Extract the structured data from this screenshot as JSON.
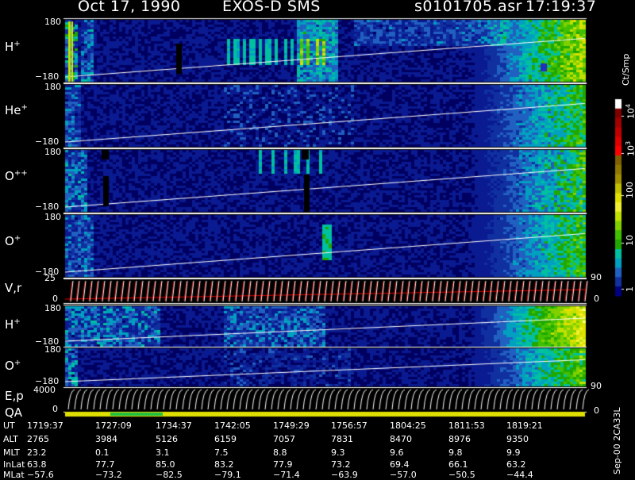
{
  "header": {
    "date": "Oct 17, 1990",
    "instrument": "EXOS-D SMS",
    "file": "s0101705.asr",
    "time": "17:19:37"
  },
  "panels": [
    {
      "label": "H",
      "sup": "+",
      "ymax": "180",
      "ymin": "−180"
    },
    {
      "label": "He",
      "sup": "+",
      "ymax": "180",
      "ymin": "−180"
    },
    {
      "label": "O",
      "sup": "++",
      "ymax": "180",
      "ymin": "−180"
    },
    {
      "label": "O",
      "sup": "+",
      "ymax": "180",
      "ymin": "−180"
    },
    {
      "label": "V,r",
      "sup": "",
      "ymax": "25",
      "ymin": "0"
    },
    {
      "label": "H",
      "sup": "+",
      "ymax": "180",
      "ymin": "−180"
    },
    {
      "label": "O",
      "sup": "+",
      "ymax": "180",
      "ymin": "−180"
    },
    {
      "label": "E,p",
      "sup": "",
      "ymax": "4000",
      "ymin": "0"
    },
    {
      "label": "QA",
      "sup": "",
      "ymax": "",
      "ymin": "0"
    }
  ],
  "right_axis": {
    "vr": [
      "90",
      "0"
    ],
    "ep": [
      "90",
      "0"
    ]
  },
  "colorbar": {
    "unit": "Ct/Smp",
    "ticks": [
      "10",
      "100",
      "10",
      "10",
      "10"
    ],
    "exps": [
      "4",
      "",
      "3",
      "",
      ""
    ],
    "bottom_ticks": [
      "1",
      "0"
    ],
    "colors": [
      "#ffffff",
      "#800000",
      "#a00000",
      "#c00000",
      "#e00000",
      "#ff0000",
      "#806000",
      "#907800",
      "#a09000",
      "#c0c000",
      "#e0e000",
      "#f0f030",
      "#c0e000",
      "#80d000",
      "#40c000",
      "#20a800",
      "#00c0a0",
      "#00a0c0",
      "#2060c0",
      "#1030a0",
      "#000080"
    ]
  },
  "footer_vertical": "Sep-00 2CA33L",
  "table": {
    "rows": [
      {
        "label": "UT",
        "values": [
          "1719:37",
          "1727:09",
          "1734:37",
          "1742:05",
          "1749:29",
          "1756:57",
          "1804:25",
          "1811:53",
          "1819:21"
        ]
      },
      {
        "label": "ALT",
        "values": [
          "2765",
          "3984",
          "5126",
          "6159",
          "7057",
          "7831",
          "8470",
          "8976",
          "9350"
        ]
      },
      {
        "label": "MLT",
        "values": [
          "23.2",
          "0.1",
          "3.1",
          "7.5",
          "8.8",
          "9.3",
          "9.6",
          "9.8",
          "9.9"
        ]
      },
      {
        "label": "InLat",
        "values": [
          "63.8",
          "77.7",
          "85.0",
          "83.2",
          "77.9",
          "73.2",
          "69.4",
          "66.1",
          "63.2"
        ]
      },
      {
        "label": "MLat",
        "values": [
          "−57.6",
          "−73.2",
          "−82.5",
          "−79.1",
          "−71.4",
          "−63.9",
          "−57.0",
          "−50.5",
          "−44.4"
        ]
      }
    ]
  }
}
